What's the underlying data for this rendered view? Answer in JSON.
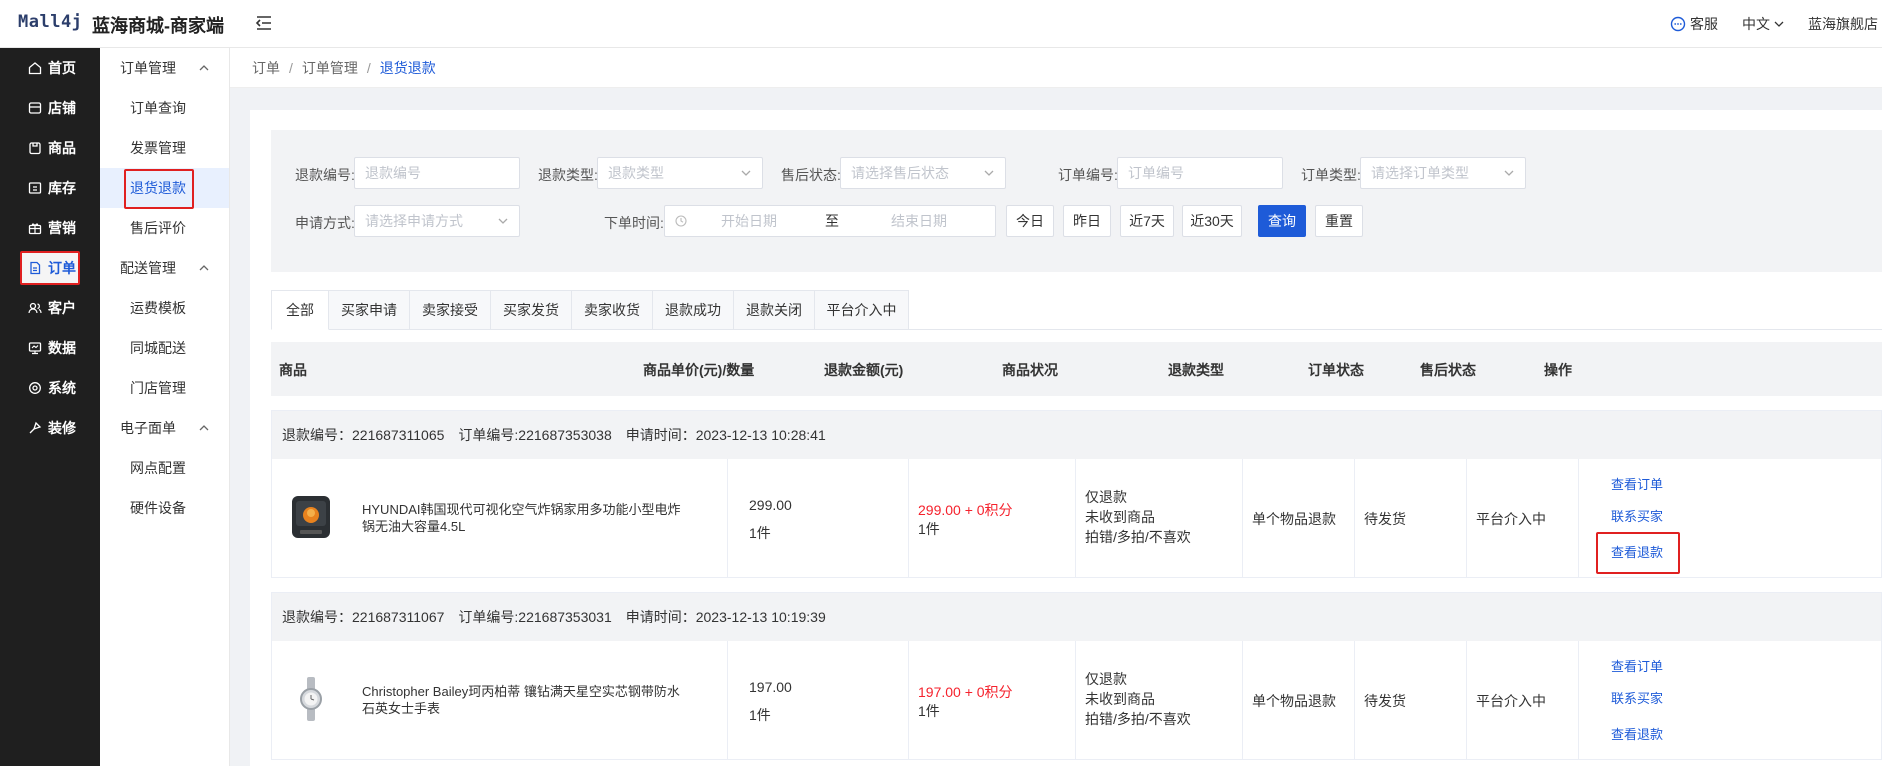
{
  "header": {
    "logo": "Mall4j",
    "shop_name": "蓝海商城-商家端",
    "service_label": "客服",
    "language_label": "中文",
    "store_label": "蓝海旗舰店"
  },
  "sidebar": {
    "items": [
      {
        "label": "首页",
        "icon": "home-icon"
      },
      {
        "label": "店铺",
        "icon": "store-icon"
      },
      {
        "label": "商品",
        "icon": "goods-icon"
      },
      {
        "label": "库存",
        "icon": "inventory-icon"
      },
      {
        "label": "营销",
        "icon": "marketing-icon"
      },
      {
        "label": "订单",
        "icon": "order-icon"
      },
      {
        "label": "客户",
        "icon": "customer-icon"
      },
      {
        "label": "数据",
        "icon": "data-icon"
      },
      {
        "label": "系统",
        "icon": "system-icon"
      },
      {
        "label": "装修",
        "icon": "decorate-icon"
      }
    ]
  },
  "subnav": {
    "group1": "订单管理",
    "group1_items": [
      "订单查询",
      "发票管理",
      "退货退款",
      "售后评价"
    ],
    "group2": "配送管理",
    "group2_items": [
      "运费模板",
      "同城配送",
      "门店管理"
    ],
    "group3": "电子面单",
    "group3_items": [
      "网点配置",
      "硬件设备"
    ]
  },
  "breadcrumb": {
    "items": [
      "订单",
      "订单管理",
      "退货退款"
    ]
  },
  "filter": {
    "refund_no_label": "退款编号:",
    "refund_no_placeholder": "退款编号",
    "refund_type_label": "退款类型:",
    "refund_type_placeholder": "退款类型",
    "aftersale_label": "售后状态:",
    "aftersale_placeholder": "请选择售后状态",
    "order_no_label": "订单编号:",
    "order_no_placeholder": "订单编号",
    "order_type_label": "订单类型:",
    "order_type_placeholder": "请选择订单类型",
    "apply_label": "申请方式:",
    "apply_placeholder": "请选择申请方式",
    "time_label": "下单时间:",
    "start_placeholder": "开始日期",
    "to": "至",
    "end_placeholder": "结束日期",
    "today": "今日",
    "yesterday": "昨日",
    "last7": "近7天",
    "last30": "近30天",
    "query": "查询",
    "reset": "重置"
  },
  "tabs": [
    "全部",
    "买家申请",
    "卖家接受",
    "买家发货",
    "卖家收货",
    "退款成功",
    "退款关闭",
    "平台介入中"
  ],
  "table": {
    "columns": [
      "商品",
      "商品单价(元)/数量",
      "退款金额(元)",
      "商品状况",
      "退款类型",
      "订单状态",
      "售后状态",
      "操作"
    ]
  },
  "orders": [
    {
      "refund_no": "退款编号：221687311065",
      "order_no": "订单编号:221687353038",
      "apply_time": "申请时间：2023-12-13 10:28:41",
      "product_name": "HYUNDAI韩国现代可视化空气炸锅家用多功能小型电炸锅无油大容量4.5L",
      "price": "299.00",
      "qty": "1件",
      "refund_amount": "299.00 + 0积分",
      "refund_qty": "1件",
      "status_lines": [
        "仅退款",
        "未收到商品",
        "拍错/多拍/不喜欢"
      ],
      "refund_type": "单个物品退款",
      "order_status": "待发货",
      "aftersale_status": "平台介入中",
      "ops": [
        "查看订单",
        "联系买家",
        "查看退款"
      ]
    },
    {
      "refund_no": "退款编号：221687311067",
      "order_no": "订单编号:221687353031",
      "apply_time": "申请时间：2023-12-13 10:19:39",
      "product_name": "Christopher Bailey珂丙柏蒂 镶钻满天星空实芯钢带防水石英女士手表",
      "price": "197.00",
      "qty": "1件",
      "refund_amount": "197.00 + 0积分",
      "refund_qty": "1件",
      "status_lines": [
        "仅退款",
        "未收到商品",
        "拍错/多拍/不喜欢"
      ],
      "refund_type": "单个物品退款",
      "order_status": "待发货",
      "aftersale_status": "平台介入中",
      "ops": [
        "查看订单",
        "联系买家",
        "查看退款"
      ]
    }
  ],
  "colors": {
    "accent": "#1e5bd8",
    "danger": "#f5222d",
    "highlight": "#e02020",
    "sidebar": "#1f1f1f"
  }
}
